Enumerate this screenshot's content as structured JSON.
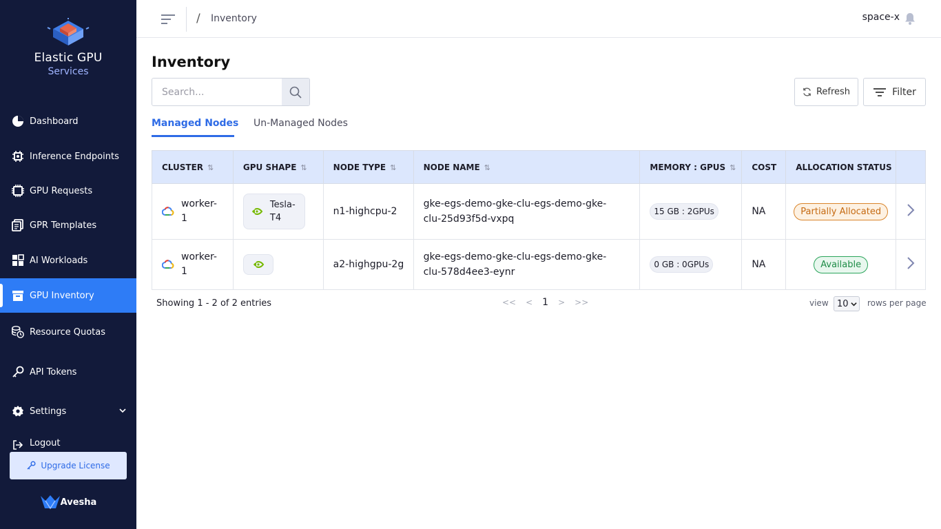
{
  "brand": {
    "title": "Elastic GPU",
    "subtitle": "Services",
    "footer": "Avesha"
  },
  "sidebar": {
    "items": [
      {
        "label": "Dashboard"
      },
      {
        "label": "Inference Endpoints"
      },
      {
        "label": "GPU Requests"
      },
      {
        "label": "GPR Templates"
      },
      {
        "label": "AI Workloads"
      },
      {
        "label": "GPU Inventory"
      },
      {
        "label": "Resource Quotas"
      },
      {
        "label": "API Tokens"
      },
      {
        "label": "Settings"
      },
      {
        "label": "Logout"
      }
    ],
    "upgrade_label": "Upgrade License"
  },
  "topbar": {
    "breadcrumb_sep": "/",
    "breadcrumb": "Inventory",
    "user": "space-x"
  },
  "main": {
    "title": "Inventory",
    "search_placeholder": "Search...",
    "refresh_label": "Refresh",
    "filter_label": "Filter",
    "tabs": [
      {
        "label": "Managed Nodes"
      },
      {
        "label": "Un-Managed Nodes"
      }
    ]
  },
  "table": {
    "headers": [
      "CLUSTER",
      "GPU SHAPE",
      "NODE TYPE",
      "NODE NAME",
      "MEMORY : GPUS",
      "COST",
      "ALLOCATION STATUS"
    ],
    "rows": [
      {
        "cluster": "worker-1",
        "gpu_shape": "Tesla-T4",
        "node_type": "n1-highcpu-2",
        "node_name": "gke-egs-demo-gke-clu-egs-demo-gke-clu-25d93f5d-vxpq",
        "memory_gpus": "15 GB : 2GPUs",
        "cost": "NA",
        "status": "Partially Allocated"
      },
      {
        "cluster": "worker-1",
        "gpu_shape": "",
        "node_type": "a2-highgpu-2g",
        "node_name": "gke-egs-demo-gke-clu-egs-demo-gke-clu-578d4ee3-eynr",
        "memory_gpus": "0 GB : 0GPUs",
        "cost": "NA",
        "status": "Available"
      }
    ]
  },
  "footer": {
    "showing": "Showing 1 - 2 of 2 entries",
    "pager": {
      "first": "<<",
      "prev": "<",
      "current": "1",
      "next": ">",
      "last": ">>"
    },
    "view_label": "view",
    "rows_per_page": "10",
    "rows_label": "rows per page"
  },
  "colors": {
    "sidebar": "#121a3a",
    "accent": "#2e7cf6",
    "header_row": "#dce7fd",
    "partial": "#d9842a",
    "available": "#2aa45a"
  },
  "icons": [
    "dashboard-icon",
    "inference-icon",
    "gpu-chip-icon",
    "templates-icon",
    "workloads-icon",
    "inventory-icon",
    "quotas-icon",
    "key-icon",
    "settings-icon",
    "logout-icon",
    "bell-icon",
    "search-icon",
    "refresh-icon",
    "filter-icon",
    "google-cloud-icon",
    "nvidia-icon",
    "chevron-right-icon"
  ]
}
